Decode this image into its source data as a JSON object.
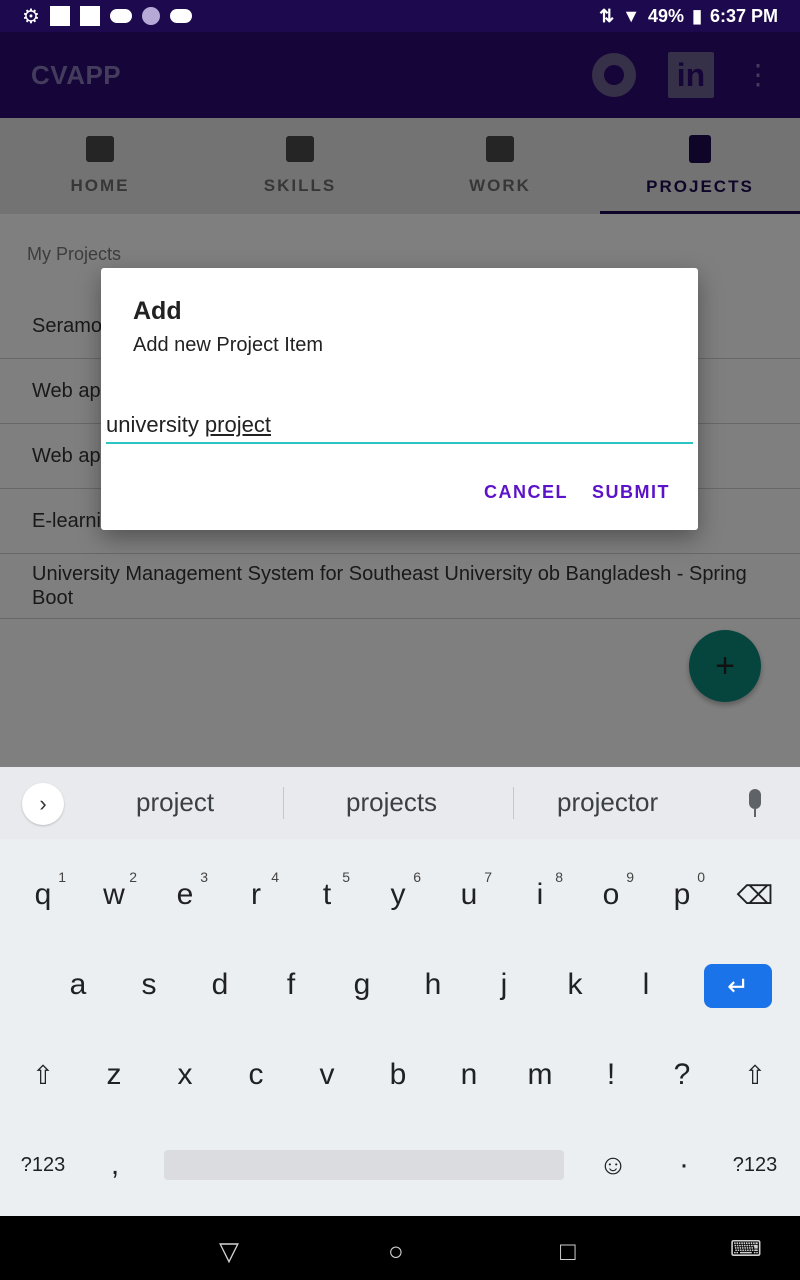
{
  "status": {
    "battery": "49%",
    "time": "6:37 PM"
  },
  "app": {
    "title": "CVAPP",
    "linkedin_glyph": "in"
  },
  "tabs": [
    {
      "label": "HOME",
      "icon": "home-icon"
    },
    {
      "label": "SKILLS",
      "icon": "help-icon"
    },
    {
      "label": "WORK",
      "icon": "briefcase-icon"
    },
    {
      "label": "PROJECTS",
      "icon": "document-person-icon",
      "active": true
    }
  ],
  "content": {
    "section_label": "My Projects",
    "projects": [
      {
        "label": "Seramo"
      },
      {
        "label": "Web ap"
      },
      {
        "label": "Web ap"
      },
      {
        "label": "E-learni"
      },
      {
        "label": "University Management System for Southeast University ob Bangladesh - Spring Boot"
      }
    ]
  },
  "dialog": {
    "title": "Add",
    "message": "Add new Project Item",
    "input_prefix": "university",
    "input_composing": "project",
    "cancel_label": "CANCEL",
    "submit_label": "SUBMIT"
  },
  "keyboard": {
    "suggestions": [
      "project",
      "projects",
      "projector"
    ],
    "row1": [
      {
        "k": "q",
        "n": "1"
      },
      {
        "k": "w",
        "n": "2"
      },
      {
        "k": "e",
        "n": "3"
      },
      {
        "k": "r",
        "n": "4"
      },
      {
        "k": "t",
        "n": "5"
      },
      {
        "k": "y",
        "n": "6"
      },
      {
        "k": "u",
        "n": "7"
      },
      {
        "k": "i",
        "n": "8"
      },
      {
        "k": "o",
        "n": "9"
      },
      {
        "k": "p",
        "n": "0"
      }
    ],
    "row2": [
      "a",
      "s",
      "d",
      "f",
      "g",
      "h",
      "j",
      "k",
      "l"
    ],
    "row3": [
      "z",
      "x",
      "c",
      "v",
      "b",
      "n",
      "m",
      "!",
      "?"
    ],
    "symbols_label": "?123",
    "comma": ",",
    "period": "·"
  },
  "colors": {
    "accent": "#5b12c9",
    "app_bar": "#2b0a70",
    "fab": "#0a8a7a",
    "input_underline": "#2ec4c4",
    "enter_key": "#1a73e8"
  }
}
